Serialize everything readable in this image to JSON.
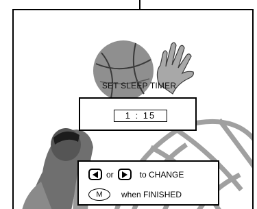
{
  "screen": {
    "title": "SET SLEEP TIMER",
    "timer_value": "1 : 15"
  },
  "instructions": {
    "separator": "or",
    "change_label": "to CHANGE",
    "m_key_label": "M",
    "finished_label": "when FINISHED",
    "left_key_icon": "left-arrow-icon",
    "right_key_icon": "right-arrow-icon"
  },
  "colors": {
    "ink": "#000000",
    "paper": "#ffffff",
    "art_gray": "#9a9a9a"
  }
}
